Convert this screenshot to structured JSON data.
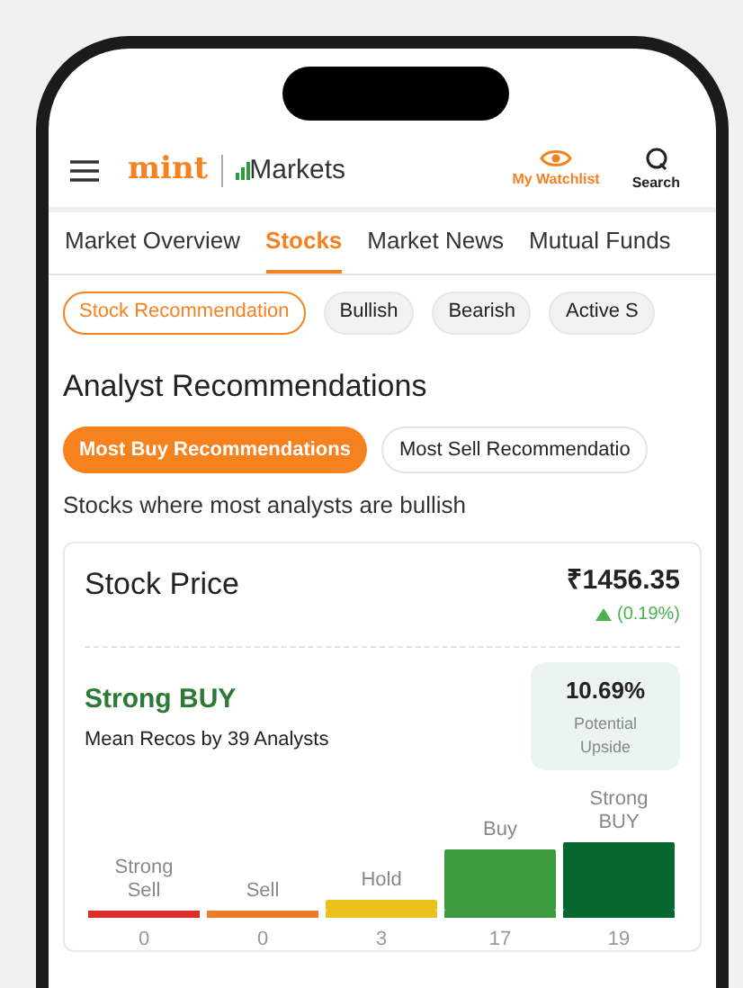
{
  "header": {
    "logo": "mint",
    "section": "Markets",
    "actions": [
      {
        "label": "My Watchlist",
        "selected": true
      },
      {
        "label": "Search",
        "selected": false
      }
    ]
  },
  "nav_tabs": [
    {
      "label": "Market Overview",
      "selected": false
    },
    {
      "label": "Stocks",
      "selected": true
    },
    {
      "label": "Market News",
      "selected": false
    },
    {
      "label": "Mutual Funds",
      "selected": false
    }
  ],
  "chips": [
    {
      "label": "Stock Recommendation",
      "selected": true
    },
    {
      "label": "Bullish",
      "selected": false
    },
    {
      "label": "Bearish",
      "selected": false
    },
    {
      "label": "Active S",
      "selected": false
    }
  ],
  "title": "Analyst Recommendations",
  "segments": [
    {
      "label": "Most Buy Recommendations",
      "selected": true
    },
    {
      "label": "Most Sell Recommendatio",
      "selected": false
    }
  ],
  "subtitle": "Stocks where most analysts are bullish",
  "card": {
    "label": "Stock Price",
    "price": "₹1456.35",
    "change": "(0.19%)",
    "rising": true,
    "rating": "Strong BUY",
    "analysts": "Mean Recos by 39 Analysts",
    "upside": {
      "value": "10.69%",
      "label": "Potential Upside"
    },
    "chart_data": {
      "type": "bar",
      "categories": [
        "Strong Sell",
        "Sell",
        "Hold",
        "Buy",
        "Strong BUY"
      ],
      "series": [
        {
          "values": [
            0,
            0,
            3,
            17,
            19
          ]
        }
      ],
      "data_labels": true
    }
  }
}
